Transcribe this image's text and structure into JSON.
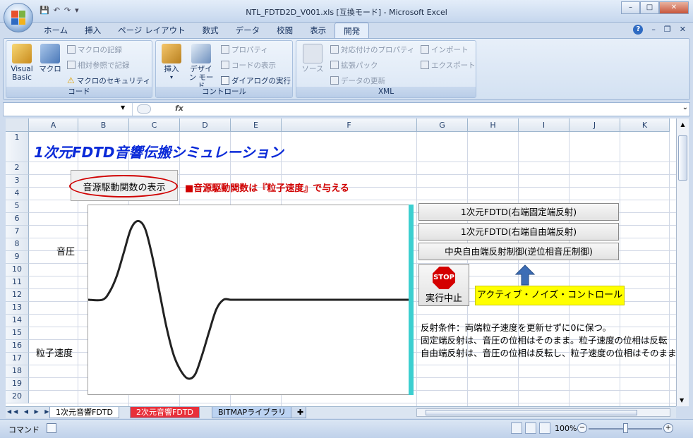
{
  "window": {
    "title": "NTL_FDTD2D_V001.xls  [互換モード] - Microsoft Excel",
    "minimize": "–",
    "maximize": "□",
    "close": "✕"
  },
  "qat": {
    "save": "💾",
    "undo": "↶",
    "redo": "↷",
    "customize": "▾"
  },
  "tabs": [
    {
      "label": "ホーム"
    },
    {
      "label": "挿入"
    },
    {
      "label": "ページ レイアウト"
    },
    {
      "label": "数式"
    },
    {
      "label": "データ"
    },
    {
      "label": "校閲"
    },
    {
      "label": "表示"
    },
    {
      "label": "開発"
    }
  ],
  "ribbon": {
    "code": {
      "label": "コード",
      "visual_basic": "Visual Basic",
      "macro": "マクロ",
      "record_macro": "マクロの記録",
      "relative_ref": "相対参照で記録",
      "macro_security": "マクロのセキュリティ"
    },
    "controls": {
      "label": "コントロール",
      "insert": "挿入",
      "design_mode": "デザイン モード",
      "properties": "プロパティ",
      "view_code": "コードの表示",
      "run_dialog": "ダイアログの実行"
    },
    "xml": {
      "label": "XML",
      "source": "ソース",
      "map_properties": "対応付けのプロパティ",
      "expansion_packs": "拡張パック",
      "refresh_data": "データの更新",
      "import": "インポート",
      "export": "エクスポート"
    }
  },
  "formula_bar": {
    "fx": "fx",
    "name": "",
    "value": ""
  },
  "columns": [
    "A",
    "B",
    "C",
    "D",
    "E",
    "F",
    "G",
    "H",
    "I",
    "J",
    "K"
  ],
  "rows": [
    "1",
    "2",
    "3",
    "4",
    "5",
    "6",
    "7",
    "8",
    "9",
    "10",
    "11",
    "12",
    "13",
    "14",
    "15",
    "16",
    "17",
    "18",
    "19",
    "20"
  ],
  "sheet": {
    "title": "1次元FDTD音響伝搬シミュレーション",
    "show_button": "音源駆動関数の表示",
    "note": "■音源駆動関数は『粒子速度』で与える",
    "label_pressure": "音圧",
    "label_velocity": "粒子速度",
    "btn_fixed": "1次元FDTD(右端固定端反射)",
    "btn_free": "1次元FDTD(右端自由端反射)",
    "btn_center": "中央自由端反射制御(逆位相音圧制御)",
    "stop_sign": "STOP",
    "stop_label": "実行中止",
    "anc_label": "アクティブ・ノイズ・コントロール",
    "desc1": "反射条件：両端粒子速度を更新せずに0に保つ。",
    "desc2": "固定端反射は、音圧の位相はそのまま。粒子速度の位相は反転",
    "desc3": "自由端反射は、音圧の位相は反転し、粒子速度の位相はそのまま"
  },
  "sheet_tabs": [
    {
      "label": "1次元音響FDTD"
    },
    {
      "label": "2次元音響FDTD"
    },
    {
      "label": "BITMAPライブラリ"
    }
  ],
  "status": {
    "mode": "コマンド",
    "zoom": "100%"
  },
  "colors": {
    "title_blue": "#0a2ad8",
    "note_red": "#d00000",
    "anc_yellow": "#ffff00",
    "cyan_bar": "#3ccfd0",
    "tab2_red": "#e8303a",
    "tab3_blue": "#2f6bc2"
  },
  "chart_data": {
    "type": "line",
    "title": "",
    "xlabel": "",
    "ylabel": "",
    "series": [
      {
        "x": [
          0,
          20,
          30,
          40,
          50,
          60,
          70,
          80,
          90,
          100,
          110,
          120,
          130,
          140,
          150,
          160,
          170,
          180,
          190,
          200,
          210,
          220,
          230,
          240,
          250,
          260,
          450
        ],
        "values": [
          0,
          0,
          0.1,
          0.3,
          0.6,
          0.9,
          1.0,
          0.9,
          0.55,
          0.1,
          -0.35,
          -0.7,
          -0.9,
          -1.0,
          -0.95,
          -0.7,
          -0.4,
          -0.12,
          0,
          0,
          0,
          0,
          0,
          0,
          0,
          0,
          0
        ]
      }
    ],
    "ylim": [
      -1.2,
      1.2
    ]
  }
}
